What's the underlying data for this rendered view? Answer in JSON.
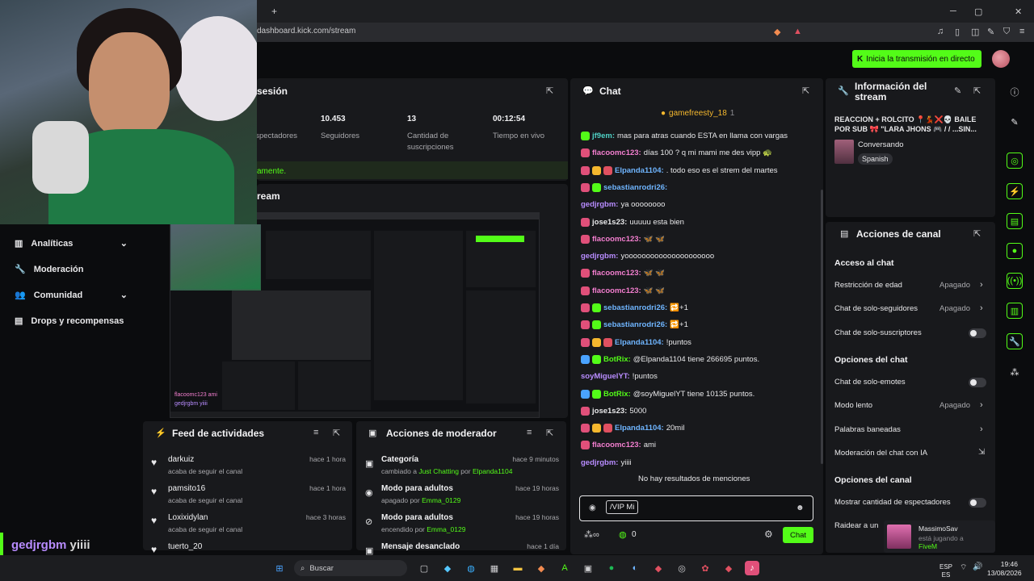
{
  "browser": {
    "tab_add": "+",
    "url": "dashboard.kick.com/stream",
    "win_min": "─",
    "win_max": "▢",
    "win_close": "✕"
  },
  "header": {
    "go_live_label": "Inicia la transmisión en directo"
  },
  "session": {
    "title": "sesión",
    "stats": [
      {
        "value": "",
        "label": "Espectadores"
      },
      {
        "value": "10.453",
        "label": "Seguidores"
      },
      {
        "value": "13",
        "label": "Cantidad de suscripciones"
      },
      {
        "value": "00:12:54",
        "label": "Tiempo en vivo"
      }
    ],
    "banner": "amente."
  },
  "stream_section_title": "ream",
  "sidebar": {
    "items": [
      {
        "label": "Analíticas",
        "icon": "chart-icon",
        "expand": "⌄"
      },
      {
        "label": "Moderación",
        "icon": "wrench-icon"
      },
      {
        "label": "Comunidad",
        "icon": "people-icon",
        "expand": "⌄"
      },
      {
        "label": "Drops y recompensas",
        "icon": "gift-icon"
      }
    ]
  },
  "overlay_chat": {
    "line1": "flacoomc123 ami",
    "line2": "gedjrgbm yiiii"
  },
  "bottom_overlay": {
    "user": "gedjrgbm",
    "msg": "yiiii"
  },
  "activity_feed": {
    "title": "Feed de actividades",
    "items": [
      {
        "name": "darkuiz",
        "action": "acaba de seguir el canal",
        "time": "hace 1 hora"
      },
      {
        "name": "pamsito16",
        "action": "acaba de seguir el canal",
        "time": "hace 1 hora"
      },
      {
        "name": "Loxixidylan",
        "action": "acaba de seguir el canal",
        "time": "hace 3 horas"
      },
      {
        "name": "tuerto_20",
        "action": "",
        "time": ""
      }
    ]
  },
  "mod_actions": {
    "title": "Acciones de moderador",
    "items": [
      {
        "title": "Categoría",
        "sub_pre": "cambiado a",
        "sub_hi1": "Just Chatting",
        "sub_mid": "por",
        "sub_hi2": "Elpanda1104",
        "time": "hace 9 minutos"
      },
      {
        "title": "Modo para adultos",
        "sub_pre": "apagado por",
        "sub_hi1": "Emma_0129",
        "sub_mid": "",
        "sub_hi2": "",
        "time": "hace 19 horas"
      },
      {
        "title": "Modo para adultos",
        "sub_pre": "encendido por",
        "sub_hi1": "Emma_0129",
        "sub_mid": "",
        "sub_hi2": "",
        "time": "hace 19 horas"
      },
      {
        "title": "Mensaje desanclado",
        "sub_pre": "",
        "sub_hi1": "",
        "sub_mid": "",
        "sub_hi2": "",
        "time": "hace 1 día"
      }
    ]
  },
  "chat": {
    "title": "Chat",
    "pinned_user": "gamefreesty_18",
    "pinned_count": "1",
    "messages": [
      {
        "user": "jf9em",
        "color": "#4fd1c5",
        "text": "mas para atras cuando ESTA en llama con vargas"
      },
      {
        "user": "flacoomc123",
        "color": "#f47fd0",
        "text": "días 100 ? q mi mami me des vipp 🐢"
      },
      {
        "user": "Elpanda1104",
        "color": "#6fb5ff",
        "text": ". todo eso es el strem del martes"
      },
      {
        "user": "sebastianrodri26",
        "color": "#6fb5ff",
        "text": ""
      },
      {
        "user": "gedjrgbm",
        "color": "#b88cff",
        "text": "ya oooooooo"
      },
      {
        "user": "jose1s23",
        "color": "#e8e8ea",
        "text": "uuuuu esta bien"
      },
      {
        "user": "flacoomc123",
        "color": "#f47fd0",
        "text": "🦋 🦋"
      },
      {
        "user": "gedjrgbm",
        "color": "#b88cff",
        "text": "yooooooooooooooooooooo"
      },
      {
        "user": "flacoomc123",
        "color": "#f47fd0",
        "text": "🦋 🦋"
      },
      {
        "user": "flacoomc123",
        "color": "#f47fd0",
        "text": "🦋 🦋"
      },
      {
        "user": "sebastianrodri26",
        "color": "#6fb5ff",
        "text": "🔁+1"
      },
      {
        "user": "sebastianrodri26",
        "color": "#6fb5ff",
        "text": "🔁+1"
      },
      {
        "user": "Elpanda1104",
        "color": "#6fb5ff",
        "text": "!puntos"
      },
      {
        "user": "BotRix",
        "color": "#53fc18",
        "text": "@Elpanda1104 tiene 266695 puntos."
      },
      {
        "user": "soyMiguelYT",
        "color": "#b88cff",
        "text": "!puntos"
      },
      {
        "user": "BotRix",
        "color": "#53fc18",
        "text": "@soyMiguelYT tiene 10135 puntos."
      },
      {
        "user": "jose1s23",
        "color": "#e8e8ea",
        "text": "5000"
      },
      {
        "user": "Elpanda1104",
        "color": "#6fb5ff",
        "text": "20mil"
      },
      {
        "user": "flacoomc123",
        "color": "#f47fd0",
        "text": "ami"
      },
      {
        "user": "gedjrgbm",
        "color": "#b88cff",
        "text": "yiiii"
      }
    ],
    "no_mentions": "No hay resultados de menciones",
    "input_value": "/VIP Mi",
    "points": "0",
    "send_label": "Chat"
  },
  "stream_info": {
    "title": "Información del stream",
    "stream_title": "REACCION + ROLCITO 📍💃❌💀 BAILE POR SUB 🎀 \"LARA JHONS 🎮 / / ...SIN...",
    "category": "Conversando",
    "language": "Spanish"
  },
  "channel_actions": {
    "title": "Acciones de canal",
    "sections": [
      {
        "heading": "Acceso al chat",
        "rows": [
          {
            "label": "Restricción de edad",
            "value": "Apagado",
            "kind": "chevron"
          },
          {
            "label": "Chat de solo-seguidores",
            "value": "Apagado",
            "kind": "chevron"
          },
          {
            "label": "Chat de solo-suscriptores",
            "value": "",
            "kind": "toggle"
          }
        ]
      },
      {
        "heading": "Opciones del chat",
        "rows": [
          {
            "label": "Chat de solo-emotes",
            "value": "",
            "kind": "toggle"
          },
          {
            "label": "Modo lento",
            "value": "Apagado",
            "kind": "chevron"
          },
          {
            "label": "Palabras baneadas",
            "value": "",
            "kind": "chevron"
          },
          {
            "label": "Moderación del chat con IA",
            "value": "",
            "kind": "external"
          }
        ]
      },
      {
        "heading": "Opciones del canal",
        "rows": [
          {
            "label": "Mostrar cantidad de espectadores",
            "value": "",
            "kind": "toggle"
          },
          {
            "label": "Raidear a un",
            "value": "",
            "kind": "none"
          }
        ]
      }
    ]
  },
  "notification": {
    "user": "MassimoSav",
    "line": "está jugando a",
    "game": "FiveM"
  },
  "taskbar": {
    "search": "Buscar",
    "time": "19:46",
    "date": "13/08/2026",
    "lang": "ESP",
    "lang2": "ES"
  },
  "colors": {
    "accent": "#53fc18",
    "panel": "#18191c",
    "bg": "#0b0c0e"
  }
}
